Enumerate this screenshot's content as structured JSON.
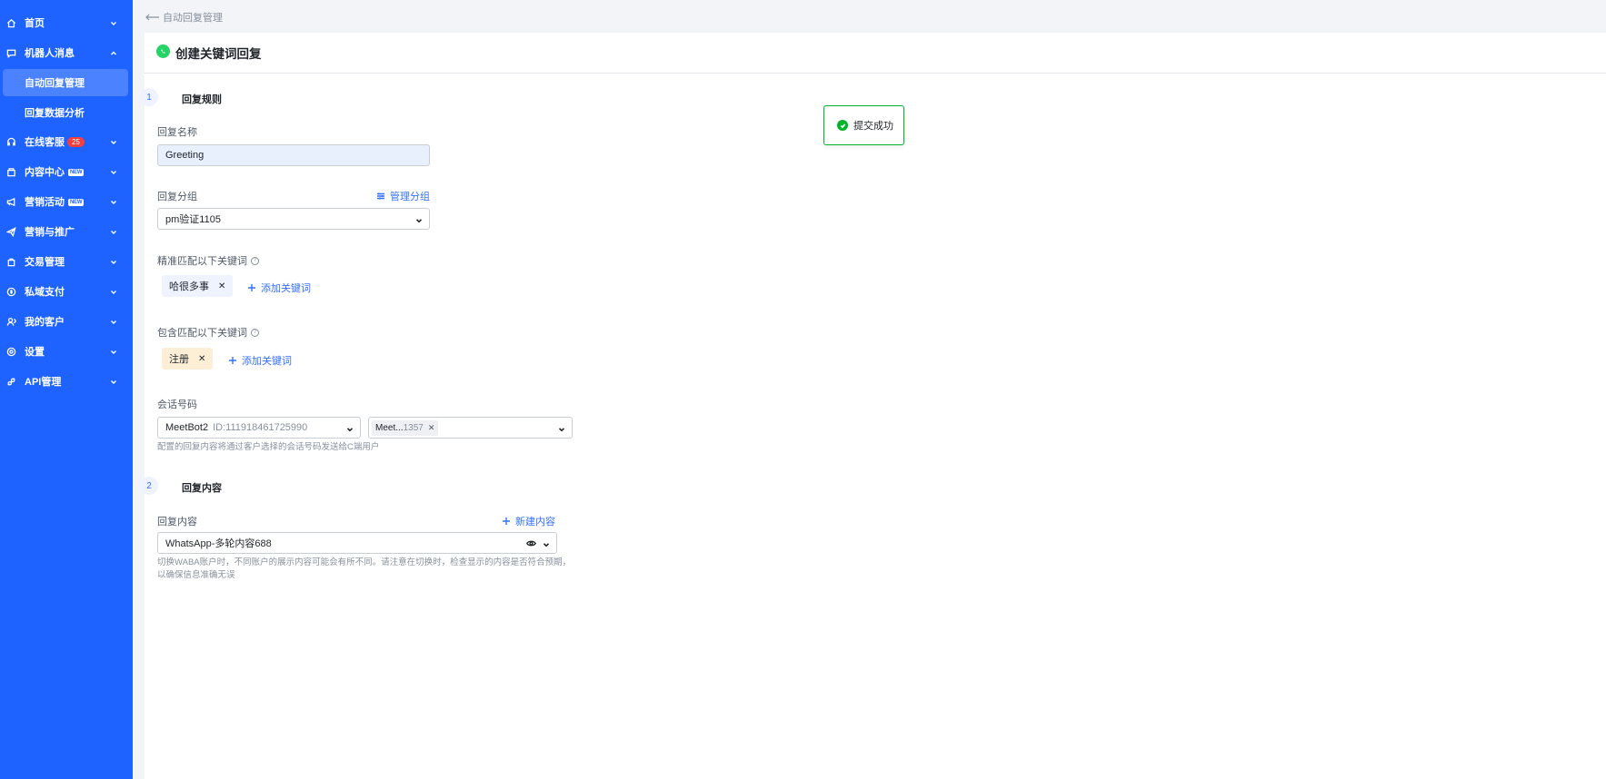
{
  "sidebar": {
    "items": [
      {
        "label": "首页",
        "icon": "home-icon"
      },
      {
        "label": "机器人消息",
        "icon": "chat-bot-icon"
      },
      {
        "label": "在线客服",
        "icon": "headset-icon",
        "badge": "25"
      },
      {
        "label": "内容中心",
        "icon": "content-icon",
        "tag": "NEW"
      },
      {
        "label": "营销活动",
        "icon": "megaphone-icon",
        "tag": "NEW"
      },
      {
        "label": "营销与推广",
        "icon": "send-icon"
      },
      {
        "label": "交易管理",
        "icon": "bag-icon"
      },
      {
        "label": "私域支付",
        "icon": "payment-icon"
      },
      {
        "label": "我的客户",
        "icon": "user-icon"
      },
      {
        "label": "设置",
        "icon": "settings-icon"
      },
      {
        "label": "API管理",
        "icon": "api-icon"
      }
    ],
    "sub_items": [
      {
        "label": "自动回复管理",
        "active": true
      },
      {
        "label": "回复数据分析",
        "active": false
      }
    ]
  },
  "breadcrumb": {
    "back_label": "自动回复管理"
  },
  "header": {
    "title": "创建关键词回复",
    "icon": "whatsapp-icon"
  },
  "toast": {
    "message": "提交成功",
    "icon": "check-circle-icon",
    "color": "#00b42a"
  },
  "step1": {
    "number": "1",
    "title": "回复规则"
  },
  "step2": {
    "number": "2",
    "title": "回复内容"
  },
  "form": {
    "reply_name_label": "回复名称",
    "reply_name_value": "Greeting",
    "group_label": "回复分组",
    "manage_group": "管理分组",
    "group_value": "pm验证1105",
    "exact_label": "精准匹配以下关键词",
    "exact_keywords": [
      "哈很多事"
    ],
    "add_keyword": "添加关键词",
    "contain_label": "包含匹配以下关键词",
    "contain_keywords": [
      "注册"
    ],
    "session_label": "会话号码",
    "session_account": "MeetBot2",
    "session_id": "ID:111918461725990",
    "session_chip_name": "Meet...",
    "session_chip_num": "1357",
    "session_hint": "配置的回复内容将通过客户选择的会话号码发送给C端用户",
    "content_label": "回复内容",
    "new_content": "新建内容",
    "content_value": "WhatsApp-多轮内容688",
    "content_hint_1": "切换WABA账户时，不同账户的展示内容可能会有所不同。请注意在切换时，检查显示的内容是否符合预期，",
    "content_hint_2": "以确保信息准确无误"
  },
  "colors": {
    "sidebar_bg": "#1e63ff",
    "accent": "#3370ff",
    "success": "#00b42a"
  }
}
